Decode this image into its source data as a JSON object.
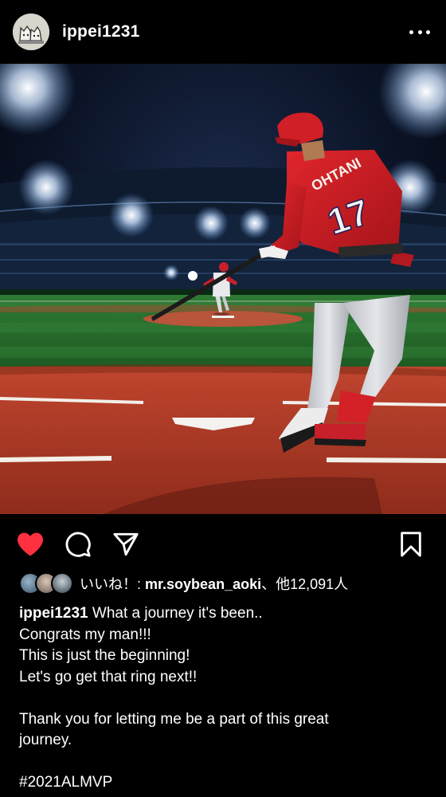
{
  "post": {
    "username": "ippei1231",
    "more_icon": "more-horizontal-icon",
    "like_icon": "heart-filled-icon",
    "comment_icon": "comment-icon",
    "share_icon": "send-icon",
    "save_icon": "bookmark-icon",
    "accent_color": "#ff3040",
    "likes": {
      "prefix": "いいね！: ",
      "user": "mr.soybean_aoki",
      "suffix": "、他12,091人"
    },
    "caption": {
      "user": "ippei1231",
      "lines": [
        "What a journey it's been..",
        "Congrats my man!!!",
        "This is just the beginning!",
        "Let's go get that ring next!!",
        "",
        "Thank you for letting me be a part of this great",
        "journey.",
        "",
        "#2021ALMVP"
      ]
    },
    "photo": {
      "jersey_name": "OHTANI",
      "jersey_number": "17"
    }
  }
}
